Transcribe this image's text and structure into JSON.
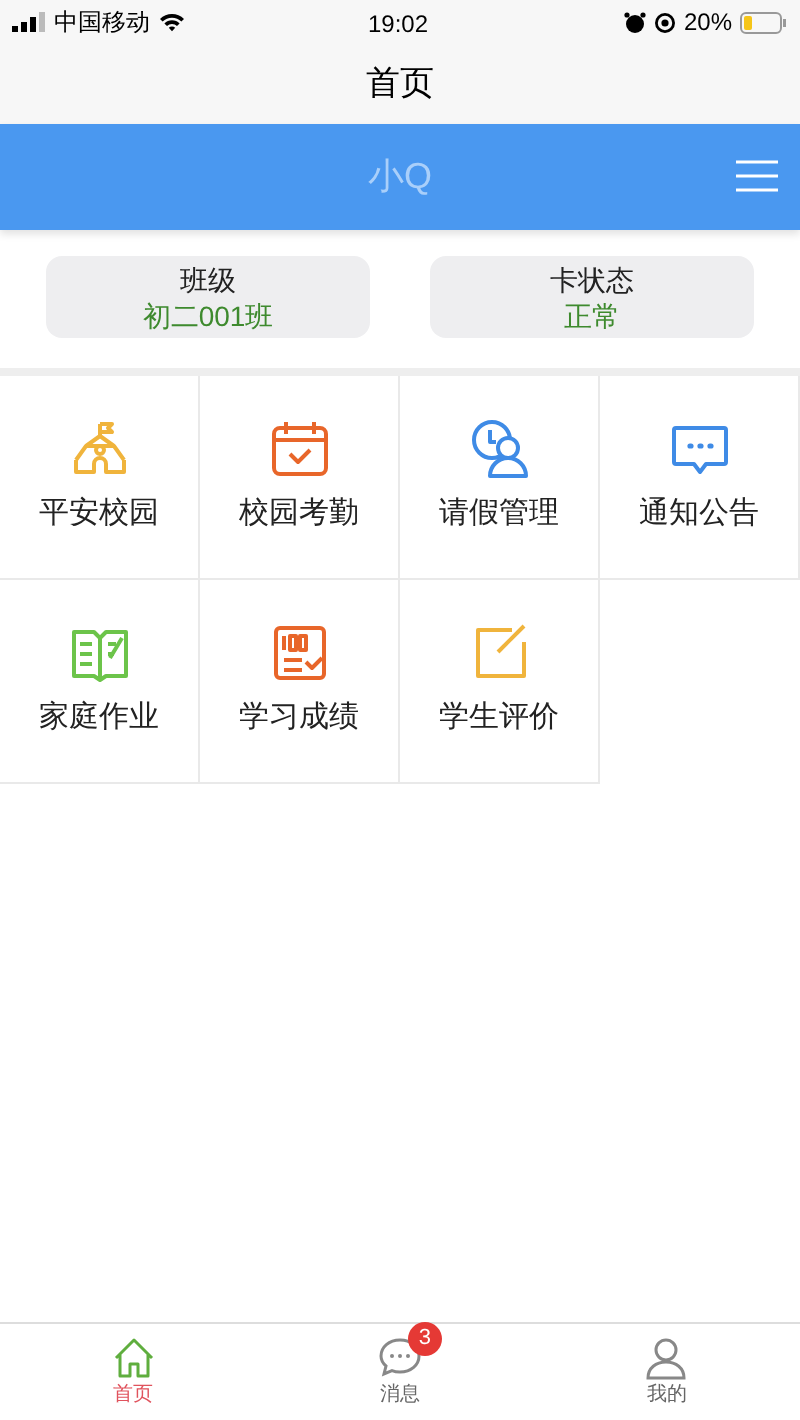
{
  "status_bar": {
    "carrier": "中国移动",
    "time": "19:02",
    "battery": "20%"
  },
  "nav_title": "首页",
  "header": {
    "logo": "小Q"
  },
  "info_cards": [
    {
      "label": "班级",
      "value": "初二001班"
    },
    {
      "label": "卡状态",
      "value": "正常"
    }
  ],
  "grid": [
    {
      "kind": "school",
      "label": "平安校园"
    },
    {
      "kind": "attendance",
      "label": "校园考勤"
    },
    {
      "kind": "leave",
      "label": "请假管理"
    },
    {
      "kind": "notice",
      "label": "通知公告"
    },
    {
      "kind": "homework",
      "label": "家庭作业"
    },
    {
      "kind": "grades",
      "label": "学习成绩"
    },
    {
      "kind": "evaluation",
      "label": "学生评价"
    }
  ],
  "tab_bar": [
    {
      "kind": "home",
      "label": "首页",
      "selected": true
    },
    {
      "kind": "messages",
      "label": "消息",
      "selected": false,
      "badge": "3"
    },
    {
      "kind": "profile",
      "label": "我的",
      "selected": false
    }
  ]
}
